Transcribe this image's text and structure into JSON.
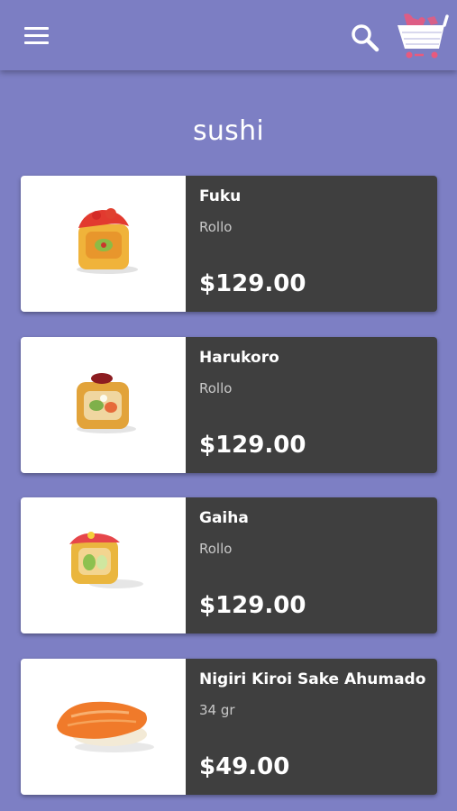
{
  "app_bar": {
    "menu_icon": "hamburger-menu-icon",
    "search_icon": "search-icon",
    "cart_icon": "shopping-cart-icon"
  },
  "page_title": "sushi",
  "products": [
    {
      "name": "Fuku",
      "subtitle": "Rollo",
      "price": "$129.00"
    },
    {
      "name": "Harukoro",
      "subtitle": "Rollo",
      "price": "$129.00"
    },
    {
      "name": "Gaiha",
      "subtitle": "Rollo",
      "price": "$129.00"
    },
    {
      "name": "Nigiri Kiroi Sake Ahumado",
      "subtitle": "34 gr",
      "price": "$49.00"
    }
  ],
  "colors": {
    "background": "#7d7fc4",
    "card_info": "#3f3f3f",
    "cart_accent": "#e85a7e"
  }
}
